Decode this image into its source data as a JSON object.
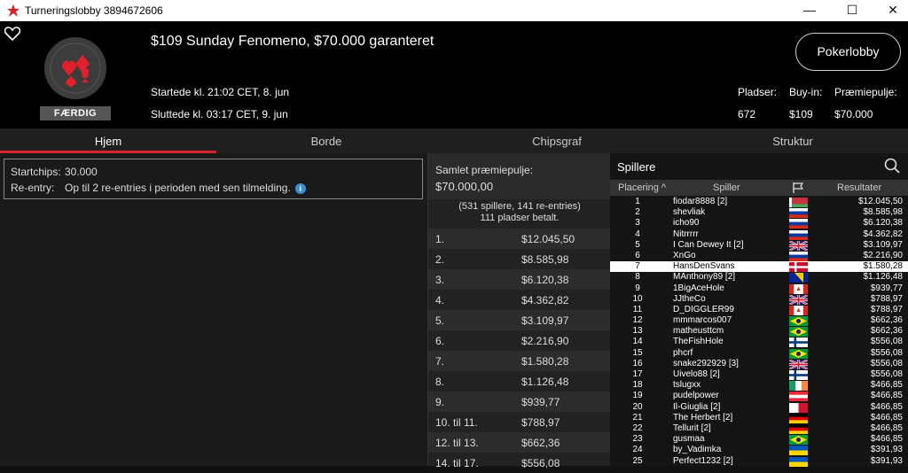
{
  "window": {
    "title": "Turneringslobby 3894672606",
    "minimize": "—",
    "maximize": "☐",
    "close": "✕"
  },
  "header": {
    "title": "$109 Sunday Fenomeno, $70.000 garanteret",
    "started": "Startede kl. 21:02 CET, 8. jun",
    "ended": "Sluttede kl. 03:17 CET, 9. jun",
    "status_badge": "FÆRDIG",
    "lobby_button": "Pokerlobby",
    "stats": [
      {
        "label": "Pladser:",
        "value": "672"
      },
      {
        "label": "Buy-in:",
        "value": "$109"
      },
      {
        "label": "Præmiepulje:",
        "value": "$70.000"
      }
    ]
  },
  "tabs": [
    {
      "label": "Hjem",
      "active": true
    },
    {
      "label": "Borde",
      "active": false
    },
    {
      "label": "Chipsgraf",
      "active": false
    },
    {
      "label": "Struktur",
      "active": false
    }
  ],
  "info": {
    "startchips_label": "Startchips:",
    "startchips_value": "30.000",
    "reentry_label": "Re-entry:",
    "reentry_value": "Op til 2 re-entries i perioden med sen tilmelding.",
    "info_icon": "i"
  },
  "prize": {
    "title": "Samlet præmiepulje:",
    "total": "$70.000,00",
    "entries": "(531 spillere, 141 re-entries)",
    "paid": "111 pladser betalt.",
    "rows": [
      {
        "place": "1.",
        "amount": "$12.045,50"
      },
      {
        "place": "2.",
        "amount": "$8.585,98"
      },
      {
        "place": "3.",
        "amount": "$6.120,38"
      },
      {
        "place": "4.",
        "amount": "$4.362,82"
      },
      {
        "place": "5.",
        "amount": "$3.109,97"
      },
      {
        "place": "6.",
        "amount": "$2.216,90"
      },
      {
        "place": "7.",
        "amount": "$1.580,28"
      },
      {
        "place": "8.",
        "amount": "$1.126,48"
      },
      {
        "place": "9.",
        "amount": "$939,77"
      },
      {
        "place": "10. til 11.",
        "amount": "$788,97"
      },
      {
        "place": "12. til 13.",
        "amount": "$662,36"
      },
      {
        "place": "14. til 17.",
        "amount": "$556,08"
      }
    ]
  },
  "players": {
    "title": "Spillere",
    "col_place": "Placering",
    "col_sort": "^",
    "col_player": "Spiller",
    "col_results": "Resultater",
    "rows": [
      {
        "rank": "1",
        "name": "fiodar8888 [2]",
        "flag": "by",
        "result": "$12.045,50"
      },
      {
        "rank": "2",
        "name": "shevliak",
        "flag": "ru",
        "result": "$8.585,98"
      },
      {
        "rank": "3",
        "name": "icho90",
        "flag": "ru",
        "result": "$6.120,38"
      },
      {
        "rank": "4",
        "name": "Nitrrrrr",
        "flag": "ru",
        "result": "$4.362,82"
      },
      {
        "rank": "5",
        "name": "I Can Dewey It [2]",
        "flag": "gb",
        "result": "$3.109,97"
      },
      {
        "rank": "6",
        "name": "XnGo",
        "flag": "ru",
        "result": "$2.216,90"
      },
      {
        "rank": "7",
        "name": "HansDenSvans",
        "flag": "dk",
        "result": "$1.580,28",
        "highlight": true
      },
      {
        "rank": "8",
        "name": "MAnthony89 [2]",
        "flag": "ba",
        "result": "$1.126,48"
      },
      {
        "rank": "9",
        "name": "1BigAceHole",
        "flag": "ca",
        "result": "$939,77"
      },
      {
        "rank": "10",
        "name": "JJtheCo",
        "flag": "gb",
        "result": "$788,97"
      },
      {
        "rank": "11",
        "name": "D_DIGGLER99",
        "flag": "ca",
        "result": "$788,97"
      },
      {
        "rank": "12",
        "name": "mmmarcos007",
        "flag": "br",
        "result": "$662,36"
      },
      {
        "rank": "13",
        "name": "matheusttcm",
        "flag": "br",
        "result": "$662,36"
      },
      {
        "rank": "14",
        "name": "TheFishHole",
        "flag": "fi",
        "result": "$556,08"
      },
      {
        "rank": "15",
        "name": "phcrf",
        "flag": "br",
        "result": "$556,08"
      },
      {
        "rank": "16",
        "name": "snake292929 [3]",
        "flag": "gb",
        "result": "$556,08"
      },
      {
        "rank": "17",
        "name": "Uivelo88 [2]",
        "flag": "fi",
        "result": "$556,08"
      },
      {
        "rank": "18",
        "name": "tslugxx",
        "flag": "ie",
        "result": "$466,85"
      },
      {
        "rank": "19",
        "name": "pudelpower",
        "flag": "at",
        "result": "$466,85"
      },
      {
        "rank": "20",
        "name": "Il-Giuglia [2]",
        "flag": "mt",
        "result": "$466,85"
      },
      {
        "rank": "21",
        "name": "The Herbert [2]",
        "flag": "de",
        "result": "$466,85"
      },
      {
        "rank": "22",
        "name": "Tellurit [2]",
        "flag": "de",
        "result": "$466,85"
      },
      {
        "rank": "23",
        "name": "gusmaa",
        "flag": "br",
        "result": "$466,85"
      },
      {
        "rank": "24",
        "name": "by_Vadimka",
        "flag": "ua",
        "result": "$391,93"
      },
      {
        "rank": "25",
        "name": "Perfect1232 [2]",
        "flag": "ua",
        "result": "$391,93"
      }
    ]
  },
  "colors": {
    "accent": "#d8222b",
    "header_bg": "#000000",
    "panel_bg": "#1a1a1a",
    "info_blue": "#3a8fd6"
  }
}
